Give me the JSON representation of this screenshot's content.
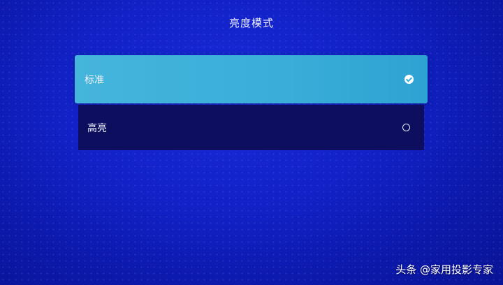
{
  "header": {
    "title": "亮度模式"
  },
  "options": [
    {
      "label": "标准",
      "selected": true,
      "icon": "check-circle-icon"
    },
    {
      "label": "高亮",
      "selected": false,
      "icon": "radio-circle-icon"
    }
  ],
  "watermark": {
    "text": "头条 @家用投影专家"
  },
  "colors": {
    "background": "#1222c8",
    "selected_option": "#3aaed8",
    "unselected_option": "#0d0f5e",
    "text": "#f2f4ff"
  }
}
